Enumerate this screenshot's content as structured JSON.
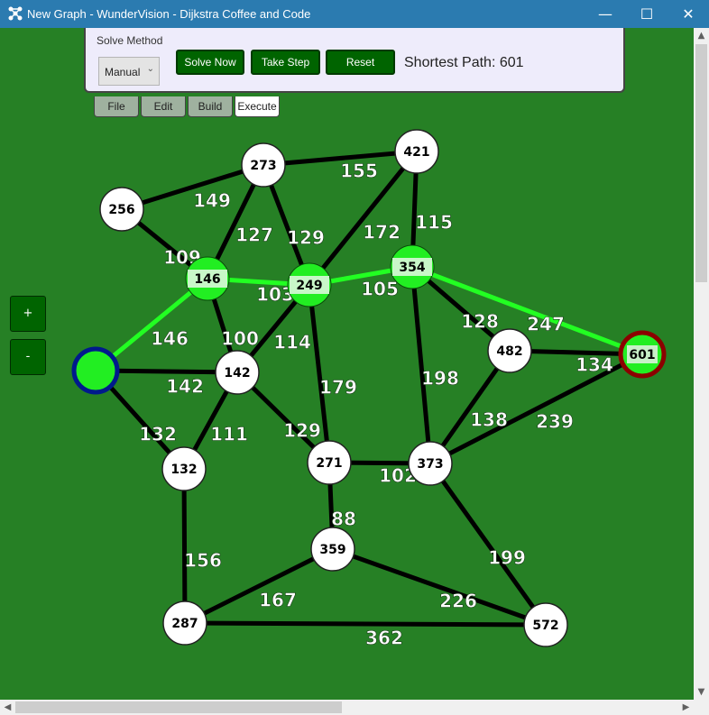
{
  "window": {
    "title": "New Graph - WunderVision - Dijkstra Coffee and Code",
    "icon": "graph-icon",
    "controls": [
      "minimize-icon",
      "maximize-icon",
      "close-icon"
    ]
  },
  "toolbar": {
    "solve_method_label": "Solve Method",
    "solve_method_value": "Manual",
    "solve_now": "Solve Now",
    "take_step": "Take Step",
    "reset": "Reset",
    "shortest_path": "Shortest Path: 601"
  },
  "tabs": [
    {
      "label": "File",
      "active": false
    },
    {
      "label": "Edit",
      "active": false
    },
    {
      "label": "Build",
      "active": false
    },
    {
      "label": "Execute",
      "active": true
    }
  ],
  "zoom": {
    "plus": "+",
    "minus": "-"
  },
  "colors": {
    "background": "#268025",
    "path": "#22ff22",
    "edge": "#000000",
    "visited": "#22ee22",
    "start_ring": "#001a8c",
    "end_ring": "#8b0000",
    "button": "#006400"
  },
  "graph": {
    "nodes": [
      {
        "id": "start",
        "label": "",
        "state": "start"
      },
      {
        "id": "n256",
        "label": "256",
        "state": "unvisited"
      },
      {
        "id": "n273",
        "label": "273",
        "state": "unvisited"
      },
      {
        "id": "n421",
        "label": "421",
        "state": "unvisited"
      },
      {
        "id": "n146",
        "label": "146",
        "state": "path"
      },
      {
        "id": "n249",
        "label": "249",
        "state": "path"
      },
      {
        "id": "n354",
        "label": "354",
        "state": "path"
      },
      {
        "id": "n142",
        "label": "142",
        "state": "unvisited"
      },
      {
        "id": "n482",
        "label": "482",
        "state": "unvisited"
      },
      {
        "id": "n601",
        "label": "601",
        "state": "end"
      },
      {
        "id": "n132",
        "label": "132",
        "state": "unvisited"
      },
      {
        "id": "n271",
        "label": "271",
        "state": "unvisited"
      },
      {
        "id": "n373",
        "label": "373",
        "state": "unvisited"
      },
      {
        "id": "n359",
        "label": "359",
        "state": "unvisited"
      },
      {
        "id": "n287",
        "label": "287",
        "state": "unvisited"
      },
      {
        "id": "n572",
        "label": "572",
        "state": "unvisited"
      }
    ],
    "edges": [
      {
        "from": "start",
        "to": "n146",
        "weight": "146",
        "on_path": true
      },
      {
        "from": "start",
        "to": "n142",
        "weight": "142",
        "on_path": false
      },
      {
        "from": "start",
        "to": "n132",
        "weight": "132",
        "on_path": false
      },
      {
        "from": "n256",
        "to": "n273",
        "weight": "149",
        "on_path": false
      },
      {
        "from": "n256",
        "to": "n146",
        "weight": "109",
        "on_path": false
      },
      {
        "from": "n273",
        "to": "n421",
        "weight": "155",
        "on_path": false
      },
      {
        "from": "n273",
        "to": "n146",
        "weight": "127",
        "on_path": false
      },
      {
        "from": "n273",
        "to": "n249",
        "weight": "129",
        "on_path": false
      },
      {
        "from": "n421",
        "to": "n249",
        "weight": "172",
        "on_path": false
      },
      {
        "from": "n421",
        "to": "n354",
        "weight": "115",
        "on_path": false
      },
      {
        "from": "n146",
        "to": "n249",
        "weight": "103",
        "on_path": true
      },
      {
        "from": "n146",
        "to": "n142",
        "weight": "100",
        "on_path": false
      },
      {
        "from": "n249",
        "to": "n354",
        "weight": "105",
        "on_path": true
      },
      {
        "from": "n249",
        "to": "n142",
        "weight": "114",
        "on_path": false
      },
      {
        "from": "n249",
        "to": "n271",
        "weight": "179",
        "on_path": false
      },
      {
        "from": "n354",
        "to": "n482",
        "weight": "128",
        "on_path": false
      },
      {
        "from": "n354",
        "to": "n601",
        "weight": "247",
        "on_path": true
      },
      {
        "from": "n354",
        "to": "n373",
        "weight": "198",
        "on_path": false
      },
      {
        "from": "n482",
        "to": "n601",
        "weight": "134",
        "on_path": false
      },
      {
        "from": "n482",
        "to": "n373",
        "weight": "138",
        "on_path": false
      },
      {
        "from": "n601",
        "to": "n373",
        "weight": "239",
        "on_path": false
      },
      {
        "from": "n142",
        "to": "n132",
        "weight": "111",
        "on_path": false
      },
      {
        "from": "n142",
        "to": "n271",
        "weight": "129",
        "on_path": false
      },
      {
        "from": "n271",
        "to": "n373",
        "weight": "102",
        "on_path": false
      },
      {
        "from": "n271",
        "to": "n359",
        "weight": "88",
        "on_path": false
      },
      {
        "from": "n132",
        "to": "n287",
        "weight": "156",
        "on_path": false
      },
      {
        "from": "n359",
        "to": "n287",
        "weight": "167",
        "on_path": false
      },
      {
        "from": "n359",
        "to": "n572",
        "weight": "226",
        "on_path": false
      },
      {
        "from": "n373",
        "to": "n572",
        "weight": "199",
        "on_path": false
      },
      {
        "from": "n287",
        "to": "n572",
        "weight": "362",
        "on_path": false
      }
    ]
  }
}
